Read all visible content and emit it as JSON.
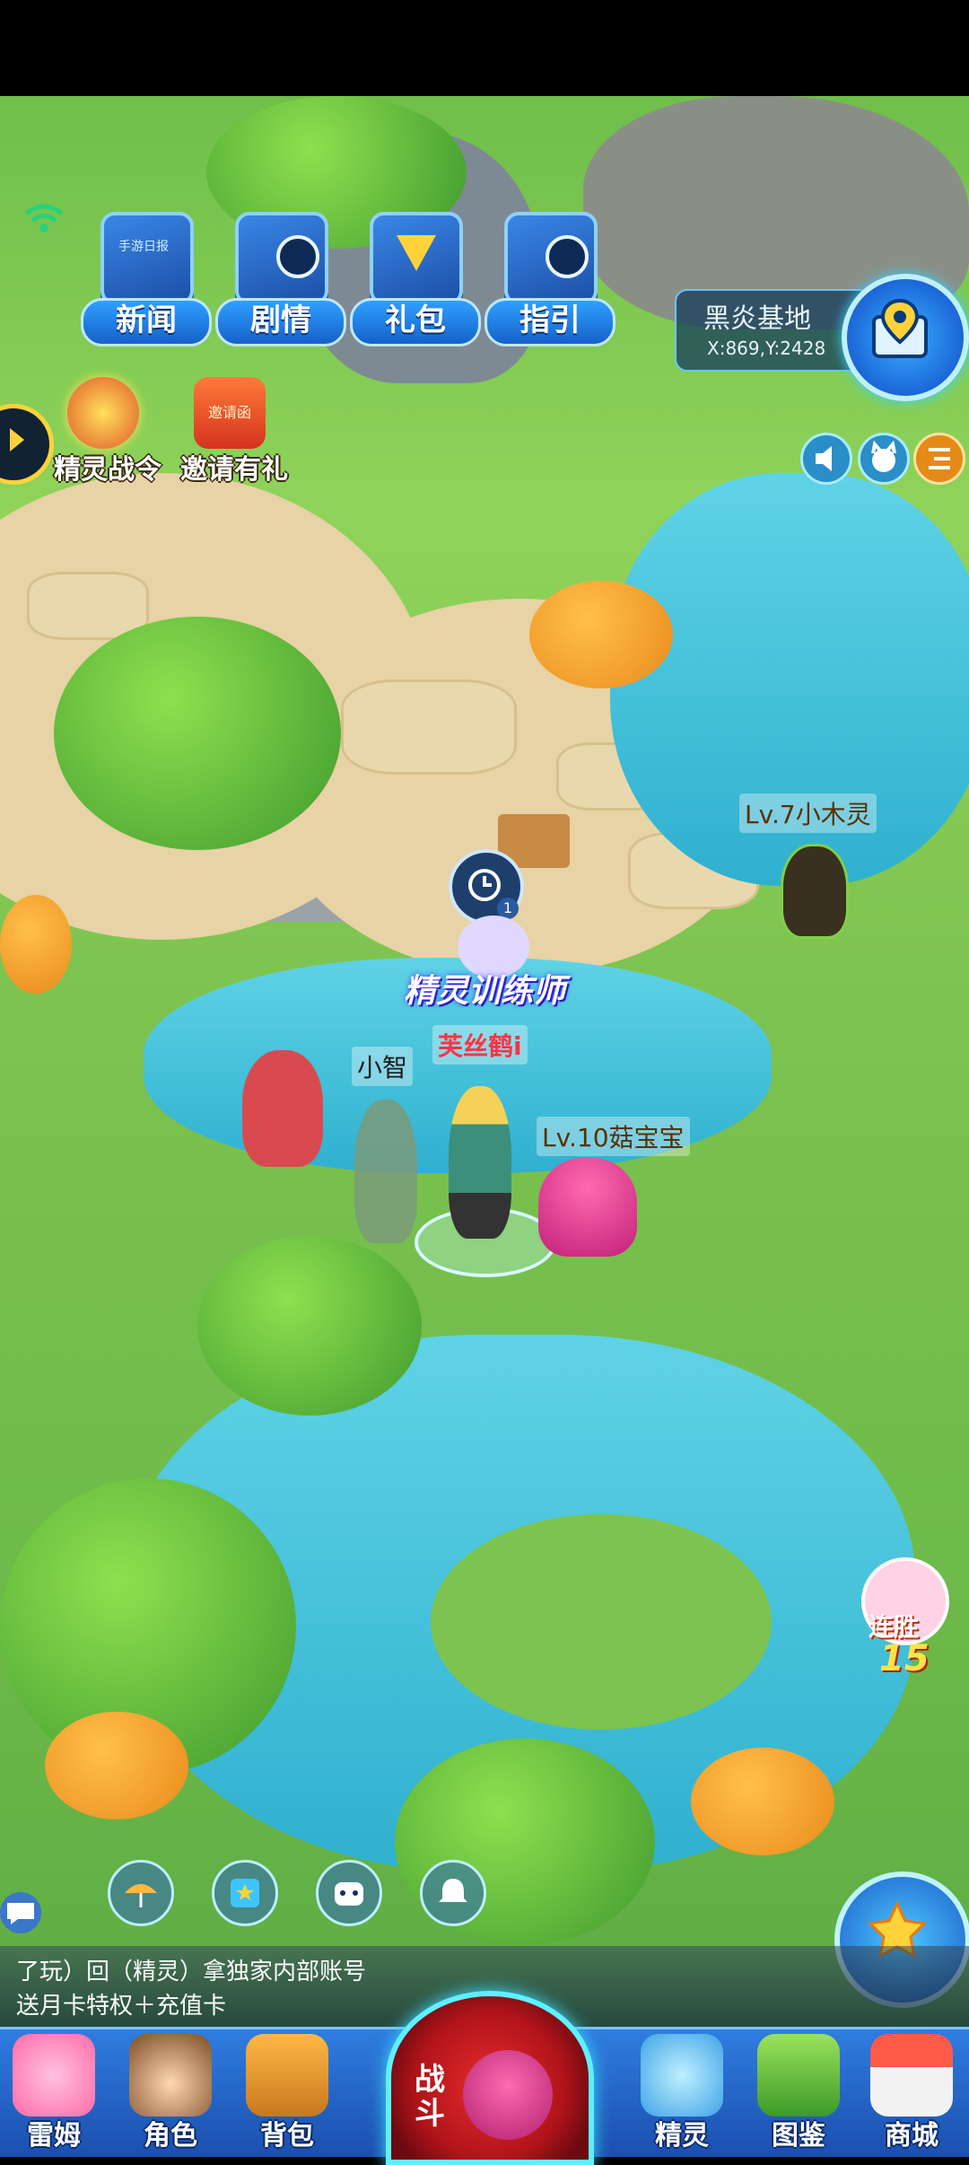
{
  "top_menu": [
    {
      "label": "新闻",
      "icon": "newspaper-tv-icon",
      "box_text": "手游日报"
    },
    {
      "label": "剧情",
      "icon": "story-device-icon"
    },
    {
      "label": "礼包",
      "icon": "gift-chest-icon"
    },
    {
      "label": "指引",
      "icon": "guide-device-icon"
    }
  ],
  "events": [
    {
      "label": "精灵战令",
      "icon": "battle-pass-icon"
    },
    {
      "label": "邀请有礼",
      "icon": "invite-gift-icon",
      "badge": "邀请函"
    }
  ],
  "location": {
    "name": "黑炎基地",
    "coords": "X:869,Y:2428"
  },
  "characters": {
    "wild_1": "Lv.7小木灵",
    "wild_2": "Lv.10菇宝宝",
    "npc": "小智",
    "player": "芙丝鹤i",
    "player_title": "精灵训练师",
    "player_badge": "1"
  },
  "streak": {
    "label": "连胜",
    "value": "15"
  },
  "chat": {
    "line1": "了玩）回（精灵）拿独家内部账号",
    "line2": "送月卡特权＋充值卡"
  },
  "bottom_nav": [
    {
      "label": "雷姆",
      "icon": "pet-rem-icon"
    },
    {
      "label": "角色",
      "icon": "character-icon"
    },
    {
      "label": "背包",
      "icon": "backpack-icon"
    },
    {
      "label": "精灵",
      "icon": "sprite-icon"
    },
    {
      "label": "图鉴",
      "icon": "codex-icon"
    },
    {
      "label": "商城",
      "icon": "shop-icon"
    }
  ],
  "battle_button": {
    "label": "战斗"
  },
  "colors": {
    "nav": "#2f7de0",
    "accent": "#5ff0ff",
    "battle": "#e62c2c"
  }
}
